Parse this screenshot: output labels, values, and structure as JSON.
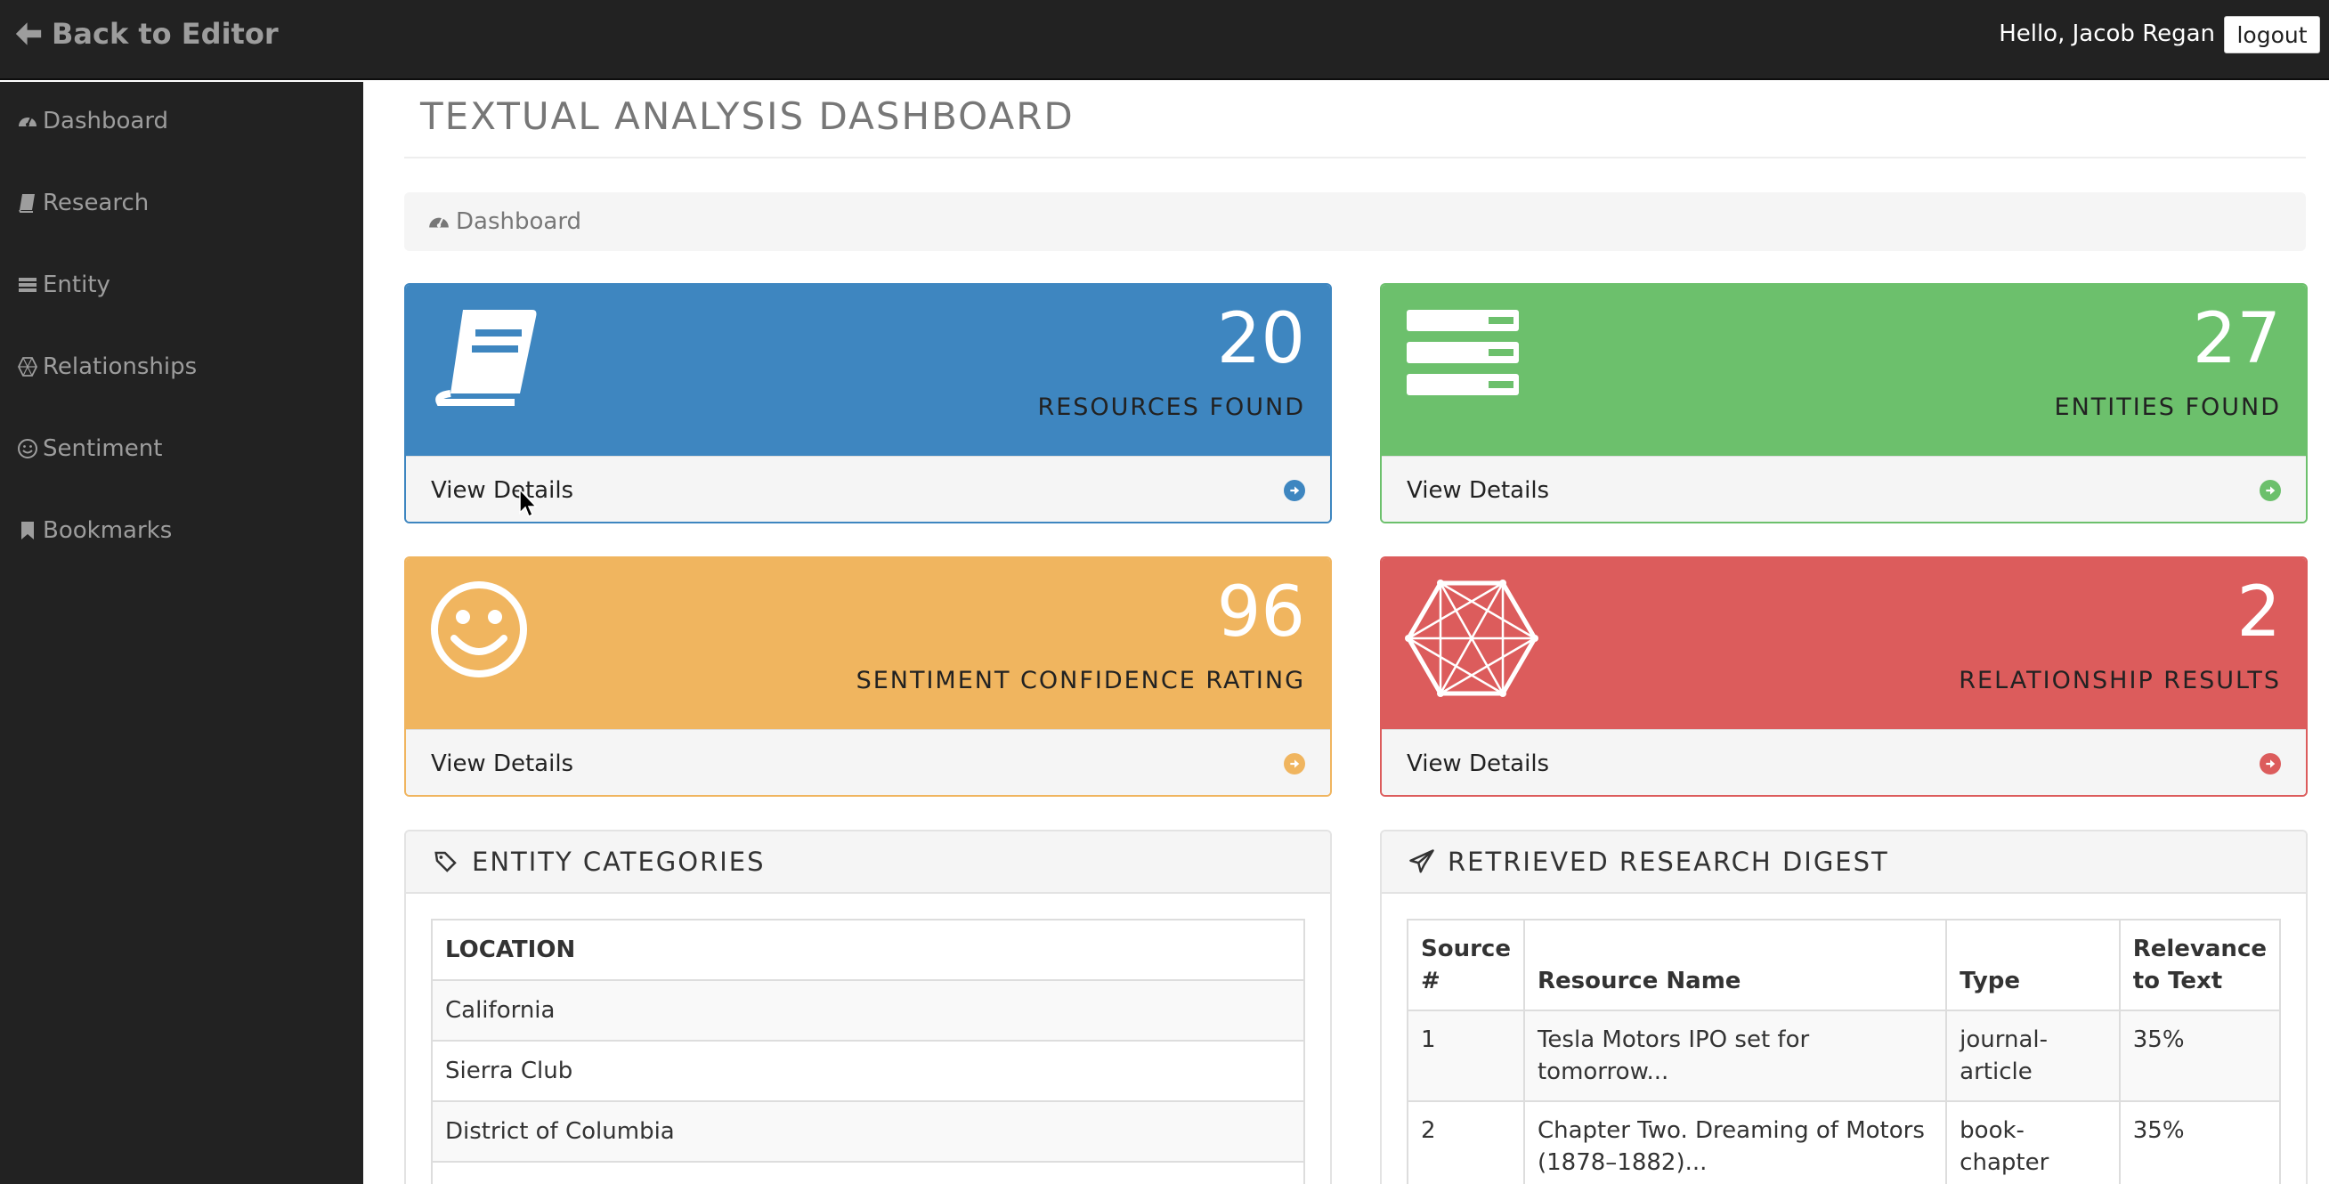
{
  "topbar": {
    "back_label": "Back to Editor",
    "greeting": "Hello, Jacob Regan",
    "logout_label": "logout"
  },
  "sidebar": {
    "items": [
      {
        "label": "Dashboard",
        "icon": "dashboard-icon"
      },
      {
        "label": "Research",
        "icon": "book-icon"
      },
      {
        "label": "Entity",
        "icon": "list-icon"
      },
      {
        "label": "Relationships",
        "icon": "network-icon"
      },
      {
        "label": "Sentiment",
        "icon": "smile-icon"
      },
      {
        "label": "Bookmarks",
        "icon": "bookmark-icon"
      }
    ]
  },
  "main": {
    "title": "TEXTUAL ANALYSIS DASHBOARD",
    "breadcrumb": "Dashboard"
  },
  "panels": [
    {
      "value": "20",
      "label": "RESOURCES FOUND",
      "link": "View Details",
      "color": "#3e86c0",
      "icon": "book-icon"
    },
    {
      "value": "27",
      "label": "ENTITIES FOUND",
      "link": "View Details",
      "color": "#6cc06c",
      "icon": "list-icon"
    },
    {
      "value": "96",
      "label": "SENTIMENT CONFIDENCE RATING",
      "link": "View Details",
      "color": "#f0b55f",
      "icon": "smile-icon"
    },
    {
      "value": "2",
      "label": "RELATIONSHIP RESULTS",
      "link": "View Details",
      "color": "#dc5c5c",
      "icon": "network-icon"
    }
  ],
  "entity_categories": {
    "title": "ENTITY CATEGORIES",
    "header": "LOCATION",
    "rows": [
      "California",
      "Sierra Club",
      "District of Columbia",
      ""
    ]
  },
  "digest": {
    "title": "RETRIEVED RESEARCH DIGEST",
    "columns": [
      "Source #",
      "Resource Name",
      "Type",
      "Relevance to Text"
    ],
    "rows": [
      {
        "num": "1",
        "name": "Tesla Motors IPO set for tomorrow...",
        "type": "journal-article",
        "relevance": "35%"
      },
      {
        "num": "2",
        "name": "Chapter Two. Dreaming of Motors (1878–1882)...",
        "type": "book-chapter",
        "relevance": "35%"
      }
    ]
  }
}
